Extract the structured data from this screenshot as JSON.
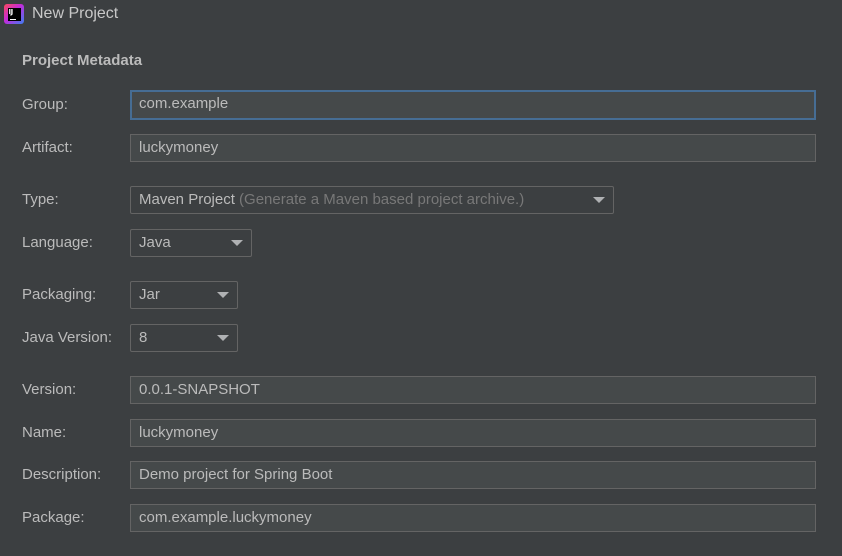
{
  "window": {
    "title": "New Project",
    "icon": "intellij-idea-icon"
  },
  "section": {
    "title": "Project Metadata"
  },
  "fields": {
    "group": {
      "label": "Group:",
      "value": "com.example"
    },
    "artifact": {
      "label": "Artifact:",
      "value": "luckymoney"
    },
    "type": {
      "label": "Type:",
      "value": "Maven Project",
      "hint": "(Generate a Maven based project archive.)"
    },
    "language": {
      "label": "Language:",
      "value": "Java"
    },
    "packaging": {
      "label": "Packaging:",
      "value": "Jar"
    },
    "java_version": {
      "label": "Java Version:",
      "value": "8"
    },
    "version": {
      "label": "Version:",
      "value": "0.0.1-SNAPSHOT"
    },
    "name": {
      "label": "Name:",
      "value": "luckymoney"
    },
    "description": {
      "label": "Description:",
      "value": "Demo project for Spring Boot"
    },
    "package": {
      "label": "Package:",
      "value": "com.example.luckymoney"
    }
  },
  "colors": {
    "background": "#3c3f41",
    "field_background": "#45494a",
    "focus_border": "#466d94",
    "text": "#bbbbbb"
  }
}
